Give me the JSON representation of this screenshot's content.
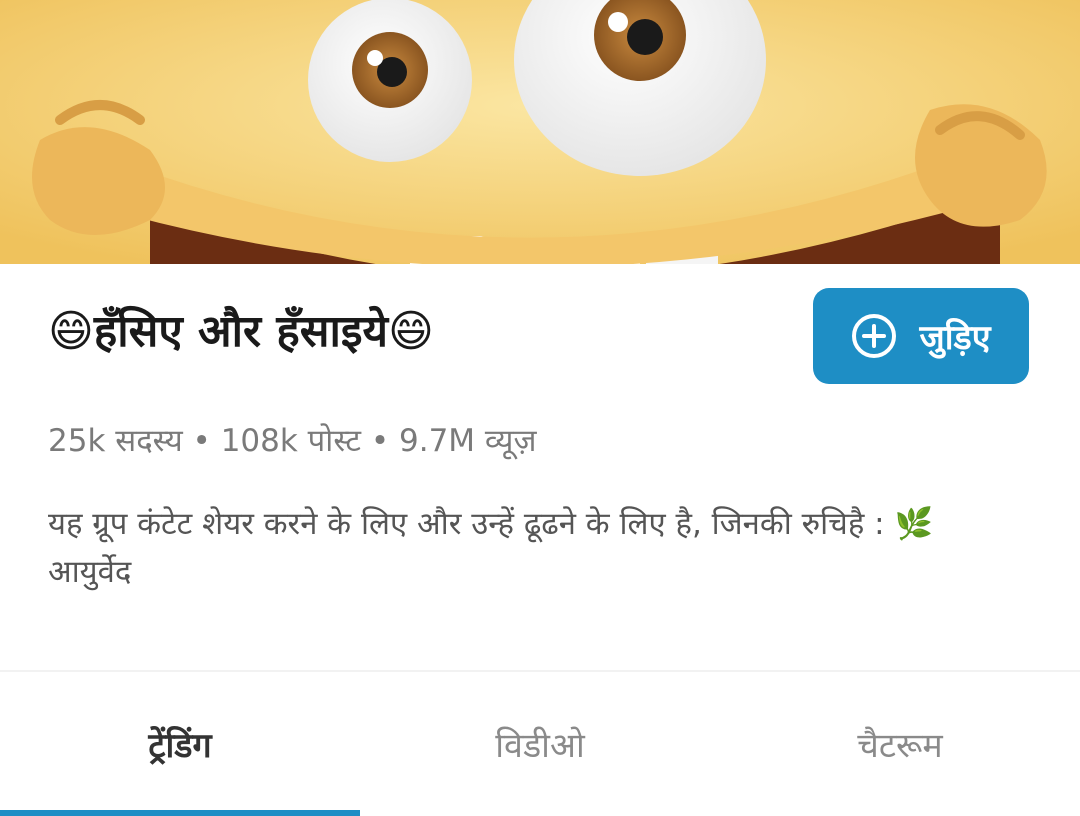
{
  "group": {
    "title": "😄हँसिए और हँसाइये😄",
    "join_label": "जुड़िए",
    "stats": "25k सदस्य • 108k पोस्ट • 9.7M व्यूज़",
    "description": "यह ग्रूप कंटेट शेयर करने के लिए और उन्हें ढूढने के लिए है, जिनकी रुचिहै : 🌿आयुर्वेद"
  },
  "tabs": [
    {
      "label": "ट्रेंडिंग",
      "active": true
    },
    {
      "label": "विडीओ",
      "active": false
    },
    {
      "label": "चैटरूम",
      "active": false
    }
  ],
  "colors": {
    "accent": "#1e8ec5",
    "banner_yellow": "#f6d77a"
  }
}
